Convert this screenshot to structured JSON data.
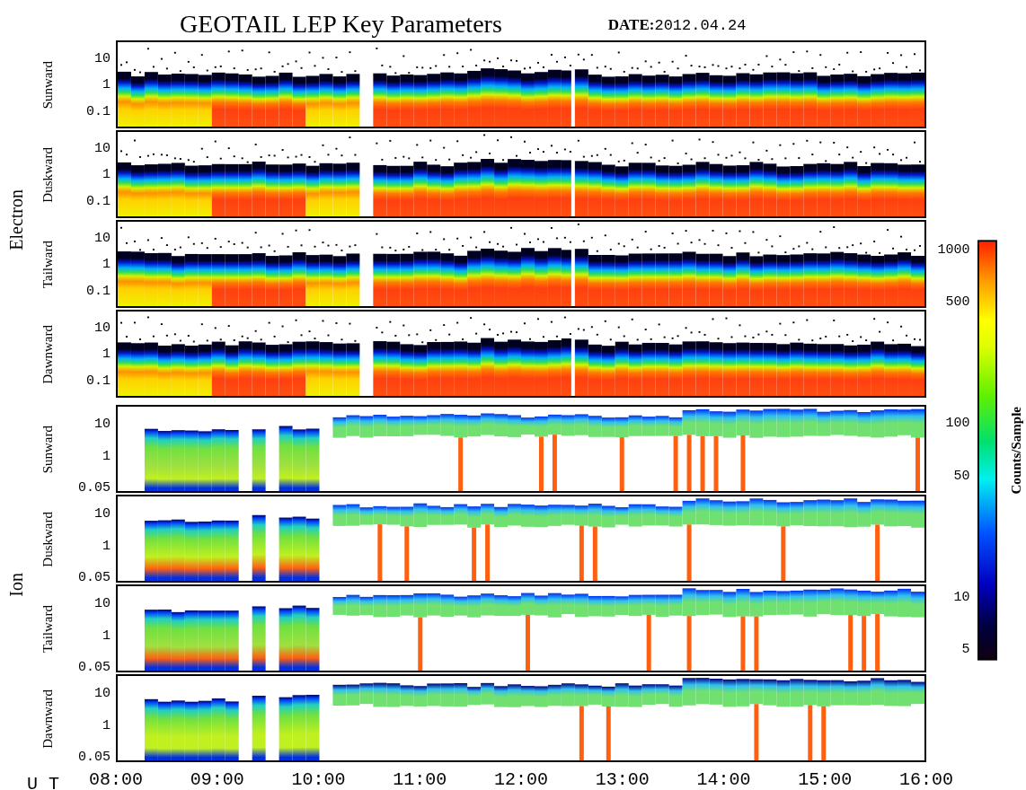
{
  "title": "GEOTAIL LEP Key Parameters",
  "date": "**DATE:**2012.04.24",
  "groups": [
    {
      "label": "Electron",
      "kind": "electron",
      "panels": [
        {
          "label": "Sunward",
          "yticks": [
            "10",
            "1",
            "0.1"
          ]
        },
        {
          "label": "Duskward",
          "yticks": [
            "10",
            "1",
            "0.1"
          ]
        },
        {
          "label": "Tailward",
          "yticks": [
            "10",
            "1",
            "0.1"
          ]
        },
        {
          "label": "Dawnward",
          "yticks": [
            "10",
            "1",
            "0.1"
          ]
        }
      ]
    },
    {
      "label": "Ion",
      "kind": "ion",
      "panels": [
        {
          "label": "Sunward",
          "yticks": [
            "10",
            "1",
            "0.05"
          ]
        },
        {
          "label": "Duskward",
          "yticks": [
            "10",
            "1",
            "0.05"
          ]
        },
        {
          "label": "Tailward",
          "yticks": [
            "10",
            "1",
            "0.05"
          ]
        },
        {
          "label": "Dawnward",
          "yticks": [
            "10",
            "1",
            "0.05"
          ]
        }
      ]
    }
  ],
  "x_axis": {
    "label": "U T",
    "ticks": [
      "08:00",
      "09:00",
      "10:00",
      "11:00",
      "12:00",
      "13:00",
      "14:00",
      "15:00",
      "16:00"
    ]
  },
  "colorbar": {
    "label": "Counts/Sample",
    "ticks": [
      "1000",
      "500",
      "100",
      "50",
      "10",
      "5"
    ]
  }
}
